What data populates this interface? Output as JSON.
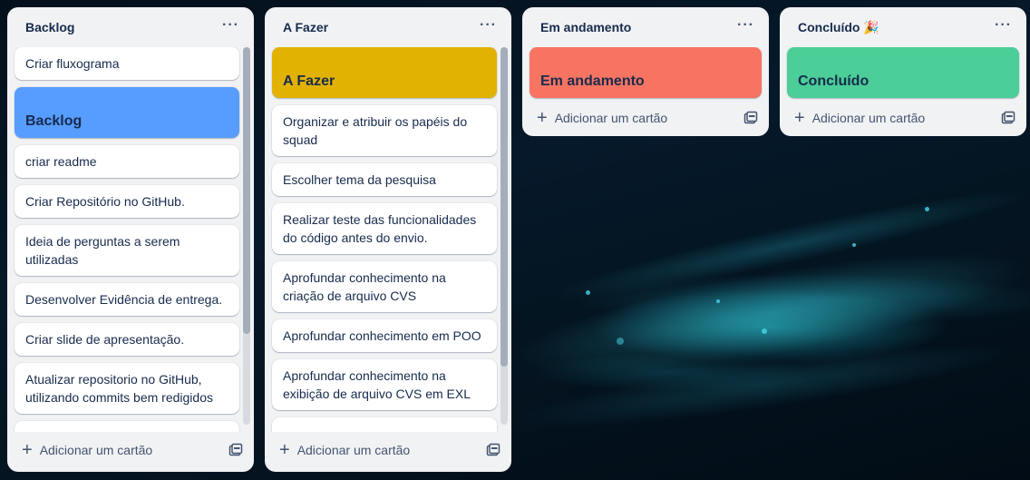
{
  "board": {
    "lists": [
      {
        "title": "Backlog",
        "cards": [
          "Criar fluxograma",
          "Backlog",
          "criar readme",
          "Criar Repositório no GitHub.",
          "Ideia de perguntas a serem utilizadas",
          "Desenvolver Evidência de entrega.",
          "Criar slide de apresentação.",
          "Atualizar repositorio no GitHub, utilizando commits bem redigidos"
        ],
        "cover_color": "#579dff",
        "add_label": "Adicionar um cartão"
      },
      {
        "title": "A Fazer",
        "cards": [
          "A Fazer",
          "Organizar e atribuir os papéis do squad",
          "Escolher tema da pesquisa",
          "Realizar teste das funcionalidades do código antes do envio.",
          "Aprofundar conhecimento na criação de arquivo CVS",
          "Aprofundar conhecimento em POO",
          "Aprofundar conhecimento na exibição de arquivo CVS em EXL"
        ],
        "cover_color": "#e2b203",
        "add_label": "Adicionar um cartão"
      },
      {
        "title": "Em andamento",
        "cards": [
          "Em andamento"
        ],
        "cover_color": "#f87462",
        "add_label": "Adicionar um cartão"
      },
      {
        "title": "Concluído",
        "title_emoji": "🎉",
        "cards": [
          "Concluído"
        ],
        "cover_color": "#4bce97",
        "add_label": "Adicionar um cartão"
      }
    ],
    "menu_glyph": "···"
  }
}
